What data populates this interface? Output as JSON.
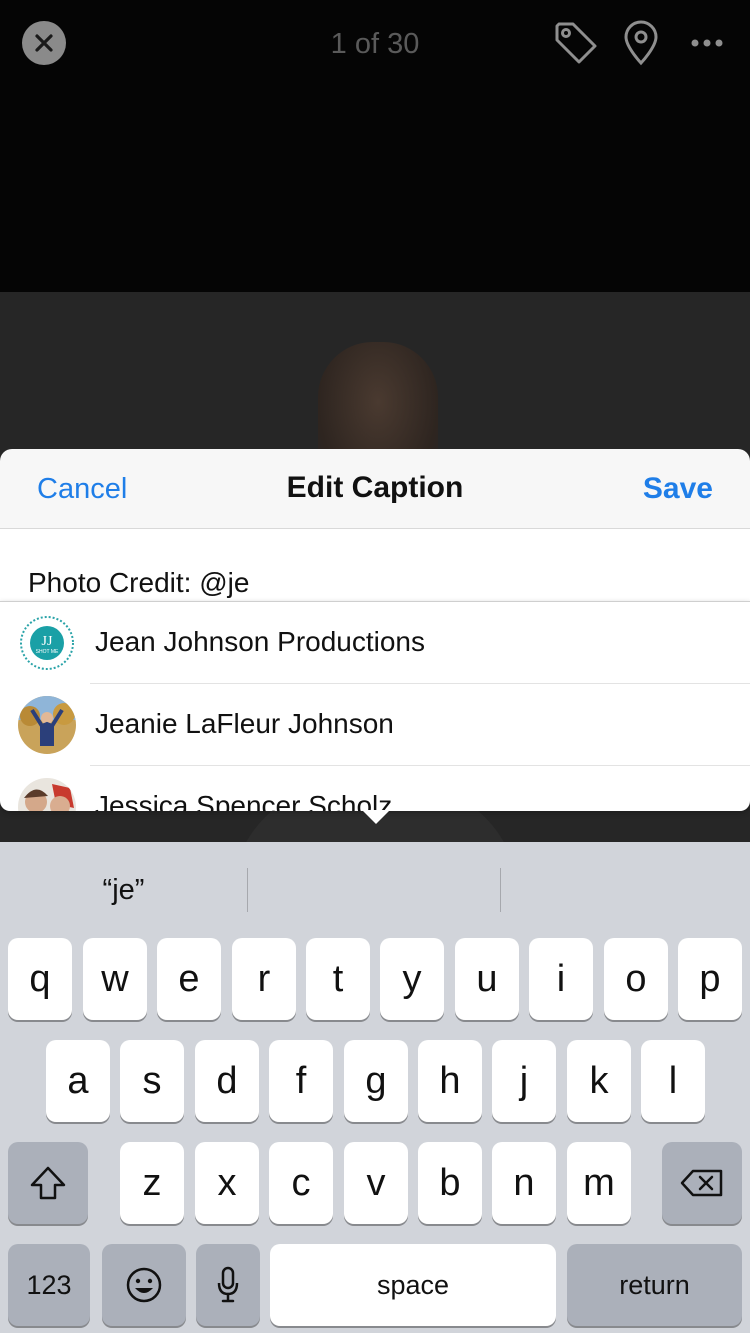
{
  "viewer": {
    "counter": "1 of 30"
  },
  "sheet": {
    "cancel": "Cancel",
    "title": "Edit Caption",
    "save": "Save"
  },
  "caption": {
    "text": "Photo Credit: @je"
  },
  "suggestions": [
    {
      "name": "Jean Johnson Productions",
      "avatar_icon": "jj-logo-icon"
    },
    {
      "name": "Jeanie LaFleur Johnson",
      "avatar_icon": "person-photo-icon"
    },
    {
      "name": "Jessica Spencer Scholz",
      "avatar_icon": "person-photo-icon"
    }
  ],
  "keyboard": {
    "prediction": "“je”",
    "row1": [
      "q",
      "w",
      "e",
      "r",
      "t",
      "y",
      "u",
      "i",
      "o",
      "p"
    ],
    "row2": [
      "a",
      "s",
      "d",
      "f",
      "g",
      "h",
      "j",
      "k",
      "l"
    ],
    "row3": [
      "z",
      "x",
      "c",
      "v",
      "b",
      "n",
      "m"
    ],
    "numbers_key": "123",
    "space_key": "space",
    "return_key": "return"
  },
  "colors": {
    "accent": "#1f7ee8",
    "keyboard_bg": "#d1d4da",
    "dark_key": "#abb0ba"
  }
}
